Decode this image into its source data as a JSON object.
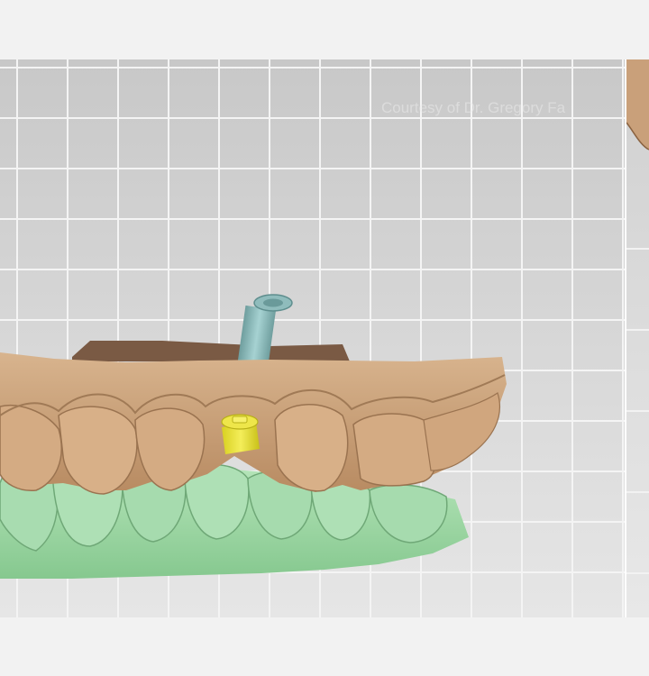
{
  "viewport": {
    "watermark_text": "Courtesy of Dr. Gregory Fa"
  },
  "scene": {
    "upper_arch_color": "#c9a07a",
    "lower_arch_color": "#9ed8a6",
    "implant_analog_color": "#8fbcbc",
    "scan_body_color": "#e8e23a",
    "gingiva_base_color": "#7a5a44"
  },
  "icons": {
    "implant": "implant-analog-icon",
    "scanbody": "scan-body-icon"
  }
}
